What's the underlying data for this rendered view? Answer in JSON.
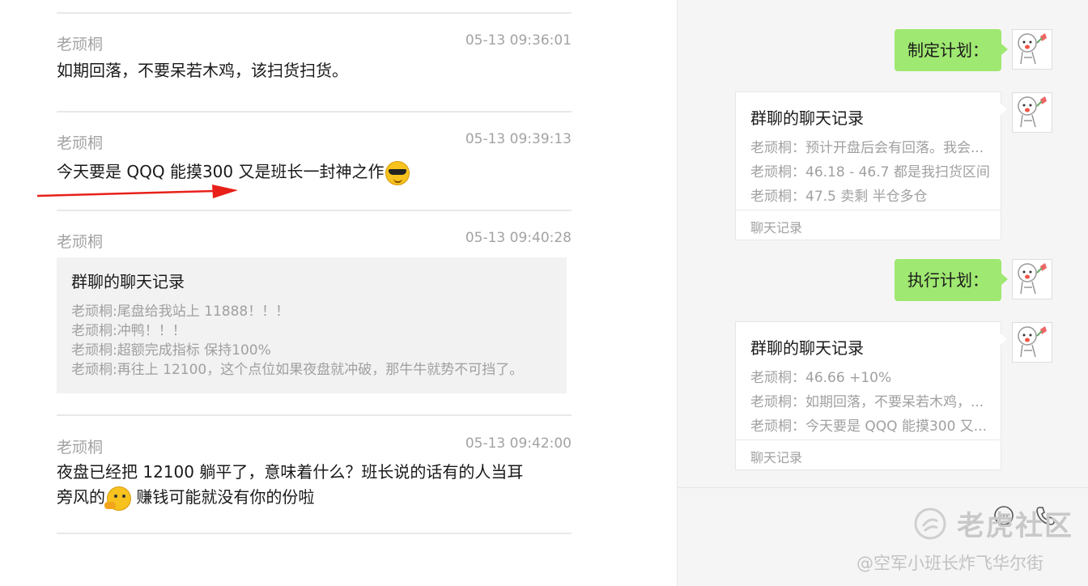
{
  "messages": [
    {
      "sender": "老顽桐",
      "time": "05-13 09:36:01",
      "text": "如期回落，不要呆若木鸡，该扫货扫货。"
    },
    {
      "sender": "老顽桐",
      "time": "05-13 09:39:13",
      "text": "今天要是 QQQ 能摸300 又是班长一封神之作"
    },
    {
      "sender": "老顽桐",
      "time": "05-13 09:40:28"
    },
    {
      "sender": "老顽桐",
      "time": "05-13 09:42:00",
      "text_line1": "夜盘已经把 12100 躺平了，意味着什么？班长说的话有的人当耳",
      "text_line2a": "旁风的",
      "text_line2b": " 赚钱可能就没有你的份啦"
    }
  ],
  "quote": {
    "title": "群聊的聊天记录",
    "lines": [
      "老顽桐:尾盘给我站上 11888！！！",
      "老顽桐:冲鸭！！！",
      "老顽桐:超额完成指标 保持100%",
      "老顽桐:再往上 12100，这个点位如果夜盘就冲破，那牛牛就势不可挡了。"
    ]
  },
  "right": {
    "plan1": "制定计划：",
    "plan2": "执行计划：",
    "card1": {
      "title": "群聊的聊天记录",
      "lines": [
        "老顽桐：预计开盘后会有回落。我会...",
        "老顽桐：46.18 - 46.7 都是我扫货区间",
        "老顽桐：47.5 卖剩 半仓多仓"
      ],
      "footer": "聊天记录"
    },
    "card2": {
      "title": "群聊的聊天记录",
      "lines": [
        "老顽桐：46.66 +10%",
        "老顽桐：如期回落，不要呆若木鸡，...",
        "老顽桐：今天要是 QQQ 能摸300 又..."
      ],
      "footer": "聊天记录"
    }
  },
  "watermark": {
    "brand": "老虎社区",
    "credit": "@空军小班长炸飞华尔街"
  },
  "colors": {
    "green_bubble": "#9fe871",
    "arrow": "#e8201a"
  }
}
